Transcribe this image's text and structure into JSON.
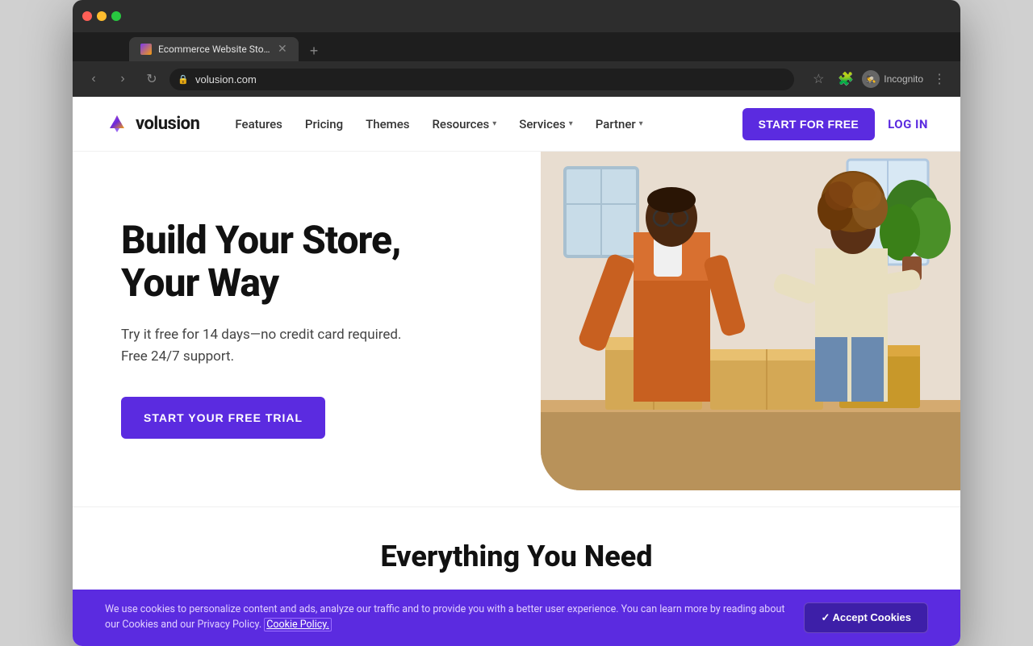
{
  "browser": {
    "tab_title": "Ecommerce Website Store & S",
    "tab_favicon_alt": "Volusion favicon",
    "address_url": "volusion.com",
    "incognito_label": "Incognito",
    "new_tab_label": "+"
  },
  "nav": {
    "logo_text": "volusion",
    "links": [
      {
        "label": "Features",
        "has_dropdown": false
      },
      {
        "label": "Pricing",
        "has_dropdown": false
      },
      {
        "label": "Themes",
        "has_dropdown": false
      },
      {
        "label": "Resources",
        "has_dropdown": true
      },
      {
        "label": "Services",
        "has_dropdown": true
      },
      {
        "label": "Partner",
        "has_dropdown": true
      }
    ],
    "cta_button": "START FOR FREE",
    "login_link": "LOG IN"
  },
  "hero": {
    "title": "Build Your Store, Your Way",
    "subtitle": "Try it free for 14 days—no credit card required. Free 24/7 support.",
    "cta_button": "START YOUR FREE TRIAL",
    "image_alt": "Two people working with boxes"
  },
  "bottom_section": {
    "title": "Everything You Need"
  },
  "cookie_banner": {
    "text": "We use cookies to personalize content and ads, analyze our traffic and to provide you with a better user experience. You can learn more by reading about our Cookies and our Privacy Policy.",
    "link_label": "Cookie Policy.",
    "accept_button": "✓ Accept Cookies"
  }
}
